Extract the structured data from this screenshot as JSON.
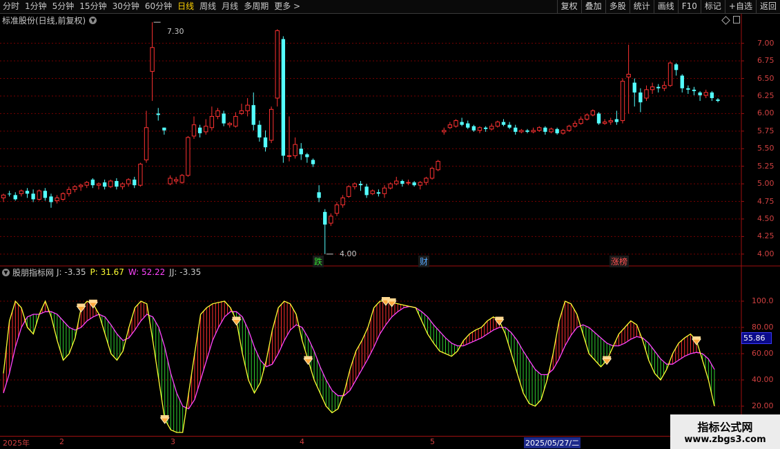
{
  "toolbar": {
    "periods": [
      "分时",
      "1分钟",
      "5分钟",
      "15分钟",
      "30分钟",
      "60分钟",
      "日线",
      "周线",
      "月线",
      "多周期",
      "更多 >"
    ],
    "active_period": "日线",
    "right_buttons": [
      "复权",
      "叠加",
      "多股",
      "统计",
      "画线",
      "F10",
      "标记",
      "+自选",
      "返回"
    ]
  },
  "stock": {
    "title": "标准股份(日线,前复权)"
  },
  "price_axis": {
    "ticks": [
      "7.00",
      "6.75",
      "6.50",
      "6.25",
      "6.00",
      "5.75",
      "5.50",
      "5.25",
      "5.00",
      "4.75",
      "4.50",
      "4.25",
      "4.00"
    ]
  },
  "annotations": {
    "high": "7.30",
    "low": "4.00"
  },
  "markers": [
    {
      "text": "跌",
      "color": "#33dd33"
    },
    {
      "text": "财",
      "color": "#55aaff"
    },
    {
      "text": "涨榜",
      "color": "#ff5050"
    }
  ],
  "indicator": {
    "name": "股朋指标网",
    "j": "J: -3.35",
    "p": "P: 31.67",
    "w": "W: 52.22",
    "jj": "JJ: -3.35",
    "axis_ticks": [
      "100.0",
      "80.00",
      "60.00",
      "40.00",
      "20.00"
    ],
    "current_value": "55.86"
  },
  "dates": {
    "labels": [
      "2025年",
      "2",
      "3",
      "4",
      "5"
    ],
    "selected": "2025/05/27/二"
  },
  "watermark": {
    "line1": "指标公式网",
    "line2": "www.zbgs3.com"
  },
  "colors": {
    "up": "#ff3232",
    "down": "#54ffff",
    "grid": "#7a0000",
    "k_line": "#ffff33",
    "d_line": "#ff44ff"
  },
  "chart_data": [
    {
      "type": "candlestick",
      "series": [
        {
          "values": [
            [
              4.8,
              4.84,
              4.74,
              4.86
            ],
            [
              4.86,
              4.85,
              4.82,
              4.9
            ],
            [
              4.84,
              4.78,
              4.76,
              4.88
            ],
            [
              4.86,
              4.9,
              4.82,
              4.92
            ],
            [
              4.9,
              4.86,
              4.8,
              4.94
            ],
            [
              4.86,
              4.78,
              4.74,
              4.92
            ],
            [
              4.78,
              4.9,
              4.76,
              4.92
            ],
            [
              4.9,
              4.8,
              4.76,
              4.94
            ],
            [
              4.82,
              4.74,
              4.66,
              4.86
            ],
            [
              4.76,
              4.8,
              4.72,
              4.84
            ],
            [
              4.78,
              4.86,
              4.76,
              4.88
            ],
            [
              4.86,
              4.92,
              4.82,
              4.96
            ],
            [
              4.92,
              4.96,
              4.88,
              4.98
            ],
            [
              4.96,
              4.98,
              4.9,
              5.0
            ],
            [
              4.98,
              5.02,
              4.94,
              5.04
            ],
            [
              5.06,
              4.98,
              4.94,
              5.08
            ],
            [
              4.98,
              5.0,
              4.92,
              5.02
            ],
            [
              5.02,
              4.96,
              4.92,
              5.06
            ],
            [
              4.96,
              5.04,
              4.94,
              5.06
            ],
            [
              5.04,
              4.96,
              4.92,
              5.08
            ],
            [
              4.96,
              5.0,
              4.92,
              5.02
            ],
            [
              5.0,
              5.06,
              4.96,
              5.08
            ],
            [
              5.06,
              4.98,
              4.94,
              5.1
            ],
            [
              4.98,
              5.28,
              4.96,
              5.3
            ],
            [
              5.34,
              5.8,
              5.3,
              6.04
            ],
            [
              6.6,
              6.94,
              6.18,
              7.3
            ],
            [
              6.0,
              5.98,
              5.9,
              6.08
            ],
            [
              5.8,
              5.76,
              5.7,
              5.8
            ],
            [
              5.0,
              5.08,
              4.98,
              5.12
            ],
            [
              5.04,
              5.06,
              5.0,
              5.1
            ],
            [
              5.02,
              5.12,
              5.0,
              5.14
            ],
            [
              5.12,
              5.66,
              5.1,
              5.68
            ],
            [
              5.68,
              5.84,
              5.64,
              5.96
            ],
            [
              5.8,
              5.72,
              5.66,
              5.84
            ],
            [
              5.74,
              5.82,
              5.7,
              5.92
            ],
            [
              5.8,
              5.96,
              5.76,
              6.1
            ],
            [
              5.96,
              6.04,
              5.92,
              6.08
            ],
            [
              6.0,
              5.86,
              5.82,
              6.04
            ],
            [
              5.84,
              5.86,
              5.8,
              5.88
            ],
            [
              5.82,
              5.96,
              5.8,
              6.02
            ],
            [
              6.0,
              6.04,
              5.98,
              6.14
            ],
            [
              6.04,
              6.12,
              5.96,
              6.22
            ],
            [
              6.12,
              5.84,
              5.76,
              6.3
            ],
            [
              5.84,
              5.66,
              5.6,
              5.9
            ],
            [
              5.66,
              5.52,
              5.46,
              5.76
            ],
            [
              5.62,
              6.06,
              5.58,
              6.1
            ],
            [
              6.22,
              7.18,
              6.1,
              7.2
            ],
            [
              7.06,
              5.4,
              5.3,
              7.1
            ],
            [
              5.4,
              5.4,
              5.32,
              5.96
            ],
            [
              5.4,
              5.56,
              5.36,
              5.66
            ],
            [
              5.5,
              5.42,
              5.34,
              5.58
            ],
            [
              5.42,
              5.38,
              5.3,
              5.44
            ],
            [
              5.34,
              5.28,
              5.24,
              5.36
            ],
            [
              4.88,
              4.8,
              4.74,
              4.98
            ],
            [
              4.6,
              4.42,
              4.0,
              4.64
            ],
            [
              4.44,
              4.54,
              4.4,
              4.58
            ],
            [
              4.58,
              4.7,
              4.54,
              4.74
            ],
            [
              4.7,
              4.8,
              4.66,
              4.84
            ],
            [
              4.82,
              4.96,
              4.8,
              4.98
            ],
            [
              4.96,
              5.0,
              4.92,
              5.02
            ],
            [
              5.0,
              4.98,
              4.9,
              5.04
            ],
            [
              4.96,
              4.84,
              4.8,
              5.0
            ],
            [
              4.86,
              4.9,
              4.84,
              4.92
            ],
            [
              4.88,
              4.86,
              4.82,
              4.92
            ],
            [
              4.86,
              4.94,
              4.8,
              4.98
            ],
            [
              4.94,
              5.0,
              4.92,
              5.02
            ],
            [
              5.0,
              5.04,
              4.98,
              5.1
            ],
            [
              5.04,
              5.0,
              4.96,
              5.06
            ],
            [
              5.02,
              5.02,
              4.98,
              5.06
            ],
            [
              5.02,
              4.98,
              4.96,
              5.04
            ],
            [
              4.98,
              5.02,
              4.92,
              5.04
            ],
            [
              5.02,
              5.08,
              4.98,
              5.1
            ],
            [
              5.08,
              5.22,
              5.06,
              5.24
            ],
            [
              5.2,
              5.32,
              5.18,
              5.34
            ],
            [
              5.74,
              5.76,
              5.7,
              5.8
            ],
            [
              5.8,
              5.84,
              5.78,
              5.88
            ],
            [
              5.82,
              5.9,
              5.8,
              5.92
            ],
            [
              5.88,
              5.84,
              5.82,
              5.94
            ],
            [
              5.86,
              5.8,
              5.78,
              5.9
            ],
            [
              5.82,
              5.76,
              5.74,
              5.84
            ],
            [
              5.76,
              5.8,
              5.72,
              5.82
            ],
            [
              5.8,
              5.78,
              5.74,
              5.82
            ],
            [
              5.78,
              5.82,
              5.76,
              5.86
            ],
            [
              5.82,
              5.88,
              5.8,
              5.9
            ],
            [
              5.88,
              5.84,
              5.82,
              5.92
            ],
            [
              5.84,
              5.8,
              5.78,
              5.88
            ],
            [
              5.8,
              5.74,
              5.7,
              5.84
            ],
            [
              5.74,
              5.76,
              5.72,
              5.78
            ],
            [
              5.76,
              5.74,
              5.72,
              5.78
            ],
            [
              5.74,
              5.76,
              5.72,
              5.8
            ],
            [
              5.76,
              5.8,
              5.74,
              5.82
            ],
            [
              5.8,
              5.74,
              5.7,
              5.82
            ],
            [
              5.74,
              5.78,
              5.72,
              5.8
            ],
            [
              5.78,
              5.72,
              5.7,
              5.8
            ],
            [
              5.72,
              5.76,
              5.7,
              5.78
            ],
            [
              5.76,
              5.82,
              5.74,
              5.84
            ],
            [
              5.82,
              5.86,
              5.8,
              5.9
            ],
            [
              5.86,
              5.92,
              5.84,
              5.96
            ],
            [
              5.92,
              5.98,
              5.9,
              6.0
            ],
            [
              5.98,
              6.04,
              5.96,
              6.06
            ],
            [
              6.0,
              5.86,
              5.84,
              6.02
            ],
            [
              5.86,
              5.88,
              5.84,
              5.92
            ],
            [
              5.88,
              5.9,
              5.84,
              5.94
            ],
            [
              5.92,
              5.88,
              5.84,
              6.04
            ],
            [
              5.9,
              6.46,
              5.86,
              6.5
            ],
            [
              6.52,
              6.56,
              6.0,
              6.98
            ],
            [
              6.44,
              6.3,
              6.1,
              6.5
            ],
            [
              6.3,
              6.16,
              6.02,
              6.36
            ],
            [
              6.22,
              6.34,
              6.18,
              6.4
            ],
            [
              6.34,
              6.38,
              6.28,
              6.44
            ],
            [
              6.38,
              6.36,
              6.3,
              6.42
            ],
            [
              6.36,
              6.4,
              6.32,
              6.46
            ],
            [
              6.4,
              6.72,
              6.38,
              6.74
            ],
            [
              6.7,
              6.62,
              6.54,
              6.72
            ],
            [
              6.54,
              6.36,
              6.3,
              6.56
            ],
            [
              6.36,
              6.34,
              6.28,
              6.4
            ],
            [
              6.34,
              6.32,
              6.26,
              6.38
            ],
            [
              6.3,
              6.26,
              6.18,
              6.32
            ],
            [
              6.26,
              6.3,
              6.22,
              6.34
            ],
            [
              6.3,
              6.22,
              6.18,
              6.32
            ],
            [
              6.2,
              6.18,
              6.16,
              6.22
            ]
          ]
        }
      ],
      "ylim": [
        3.9,
        7.4
      ]
    },
    {
      "type": "line",
      "series": [
        {
          "values": [
            45,
            85,
            100,
            95,
            80,
            75,
            90,
            100,
            88,
            70,
            55,
            60,
            72,
            95,
            100,
            98,
            90,
            75,
            60,
            55,
            62,
            80,
            95,
            100,
            98,
            70,
            40,
            10,
            2,
            0,
            0,
            30,
            60,
            90,
            95,
            98,
            99,
            100,
            95,
            85,
            60,
            40,
            30,
            38,
            55,
            78,
            95,
            100,
            98,
            90,
            70,
            55,
            40,
            30,
            20,
            15,
            18,
            30,
            48,
            62,
            70,
            80,
            95,
            100,
            100,
            99,
            98,
            97,
            96,
            95,
            85,
            75,
            68,
            62,
            60,
            58,
            62,
            70,
            75,
            78,
            80,
            85,
            88,
            85,
            75,
            60,
            45,
            30,
            22,
            20,
            25,
            40,
            60,
            85,
            100,
            98,
            90,
            75,
            60,
            55,
            50,
            55,
            65,
            75,
            80,
            85,
            82,
            70,
            55,
            45,
            40,
            48,
            60,
            68,
            72,
            75,
            70,
            55,
            40,
            20
          ]
        },
        {
          "values": [
            30,
            45,
            65,
            80,
            88,
            90,
            90,
            92,
            92,
            90,
            85,
            80,
            78,
            80,
            85,
            88,
            90,
            88,
            82,
            75,
            70,
            72,
            78,
            85,
            90,
            88,
            80,
            65,
            45,
            30,
            20,
            18,
            25,
            40,
            55,
            70,
            80,
            88,
            92,
            92,
            88,
            78,
            65,
            55,
            50,
            52,
            60,
            70,
            78,
            82,
            80,
            72,
            62,
            50,
            40,
            32,
            28,
            28,
            32,
            40,
            48,
            56,
            65,
            75,
            82,
            88,
            92,
            95,
            96,
            95,
            92,
            88,
            82,
            77,
            72,
            68,
            66,
            66,
            68,
            70,
            72,
            75,
            78,
            80,
            80,
            76,
            70,
            62,
            55,
            48,
            44,
            44,
            48,
            56,
            66,
            74,
            80,
            82,
            80,
            76,
            72,
            68,
            66,
            66,
            68,
            71,
            73,
            72,
            68,
            62,
            56,
            52,
            52,
            55,
            58,
            60,
            61,
            60,
            56,
            48
          ]
        }
      ],
      "ylim": [
        0,
        120
      ]
    }
  ]
}
